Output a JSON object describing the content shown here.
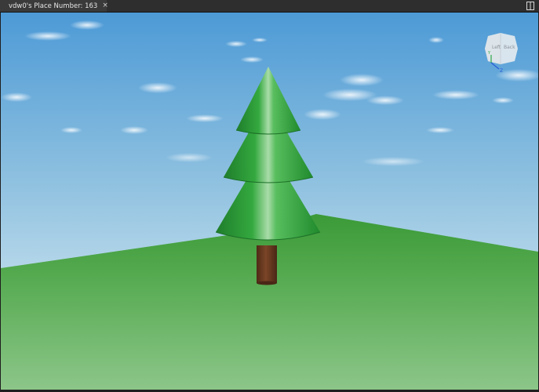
{
  "tab": {
    "title": "vdw0's Place Number: 163",
    "close_glyph": "×",
    "icon": "cloud-icon"
  },
  "toolbar": {
    "split_icon": "split-view-icon"
  },
  "nav_cube": {
    "left_face": "Left",
    "back_face": "Back",
    "axis_z": "Z",
    "axis_y": "Y"
  },
  "colors": {
    "sky_top": "#5aa2d8",
    "sky_horizon": "#cfe4ef",
    "ground_far": "#3e9a3a",
    "ground_near": "#86c283",
    "tree_green": "#2f9a3a",
    "trunk_brown": "#6a3a22"
  }
}
